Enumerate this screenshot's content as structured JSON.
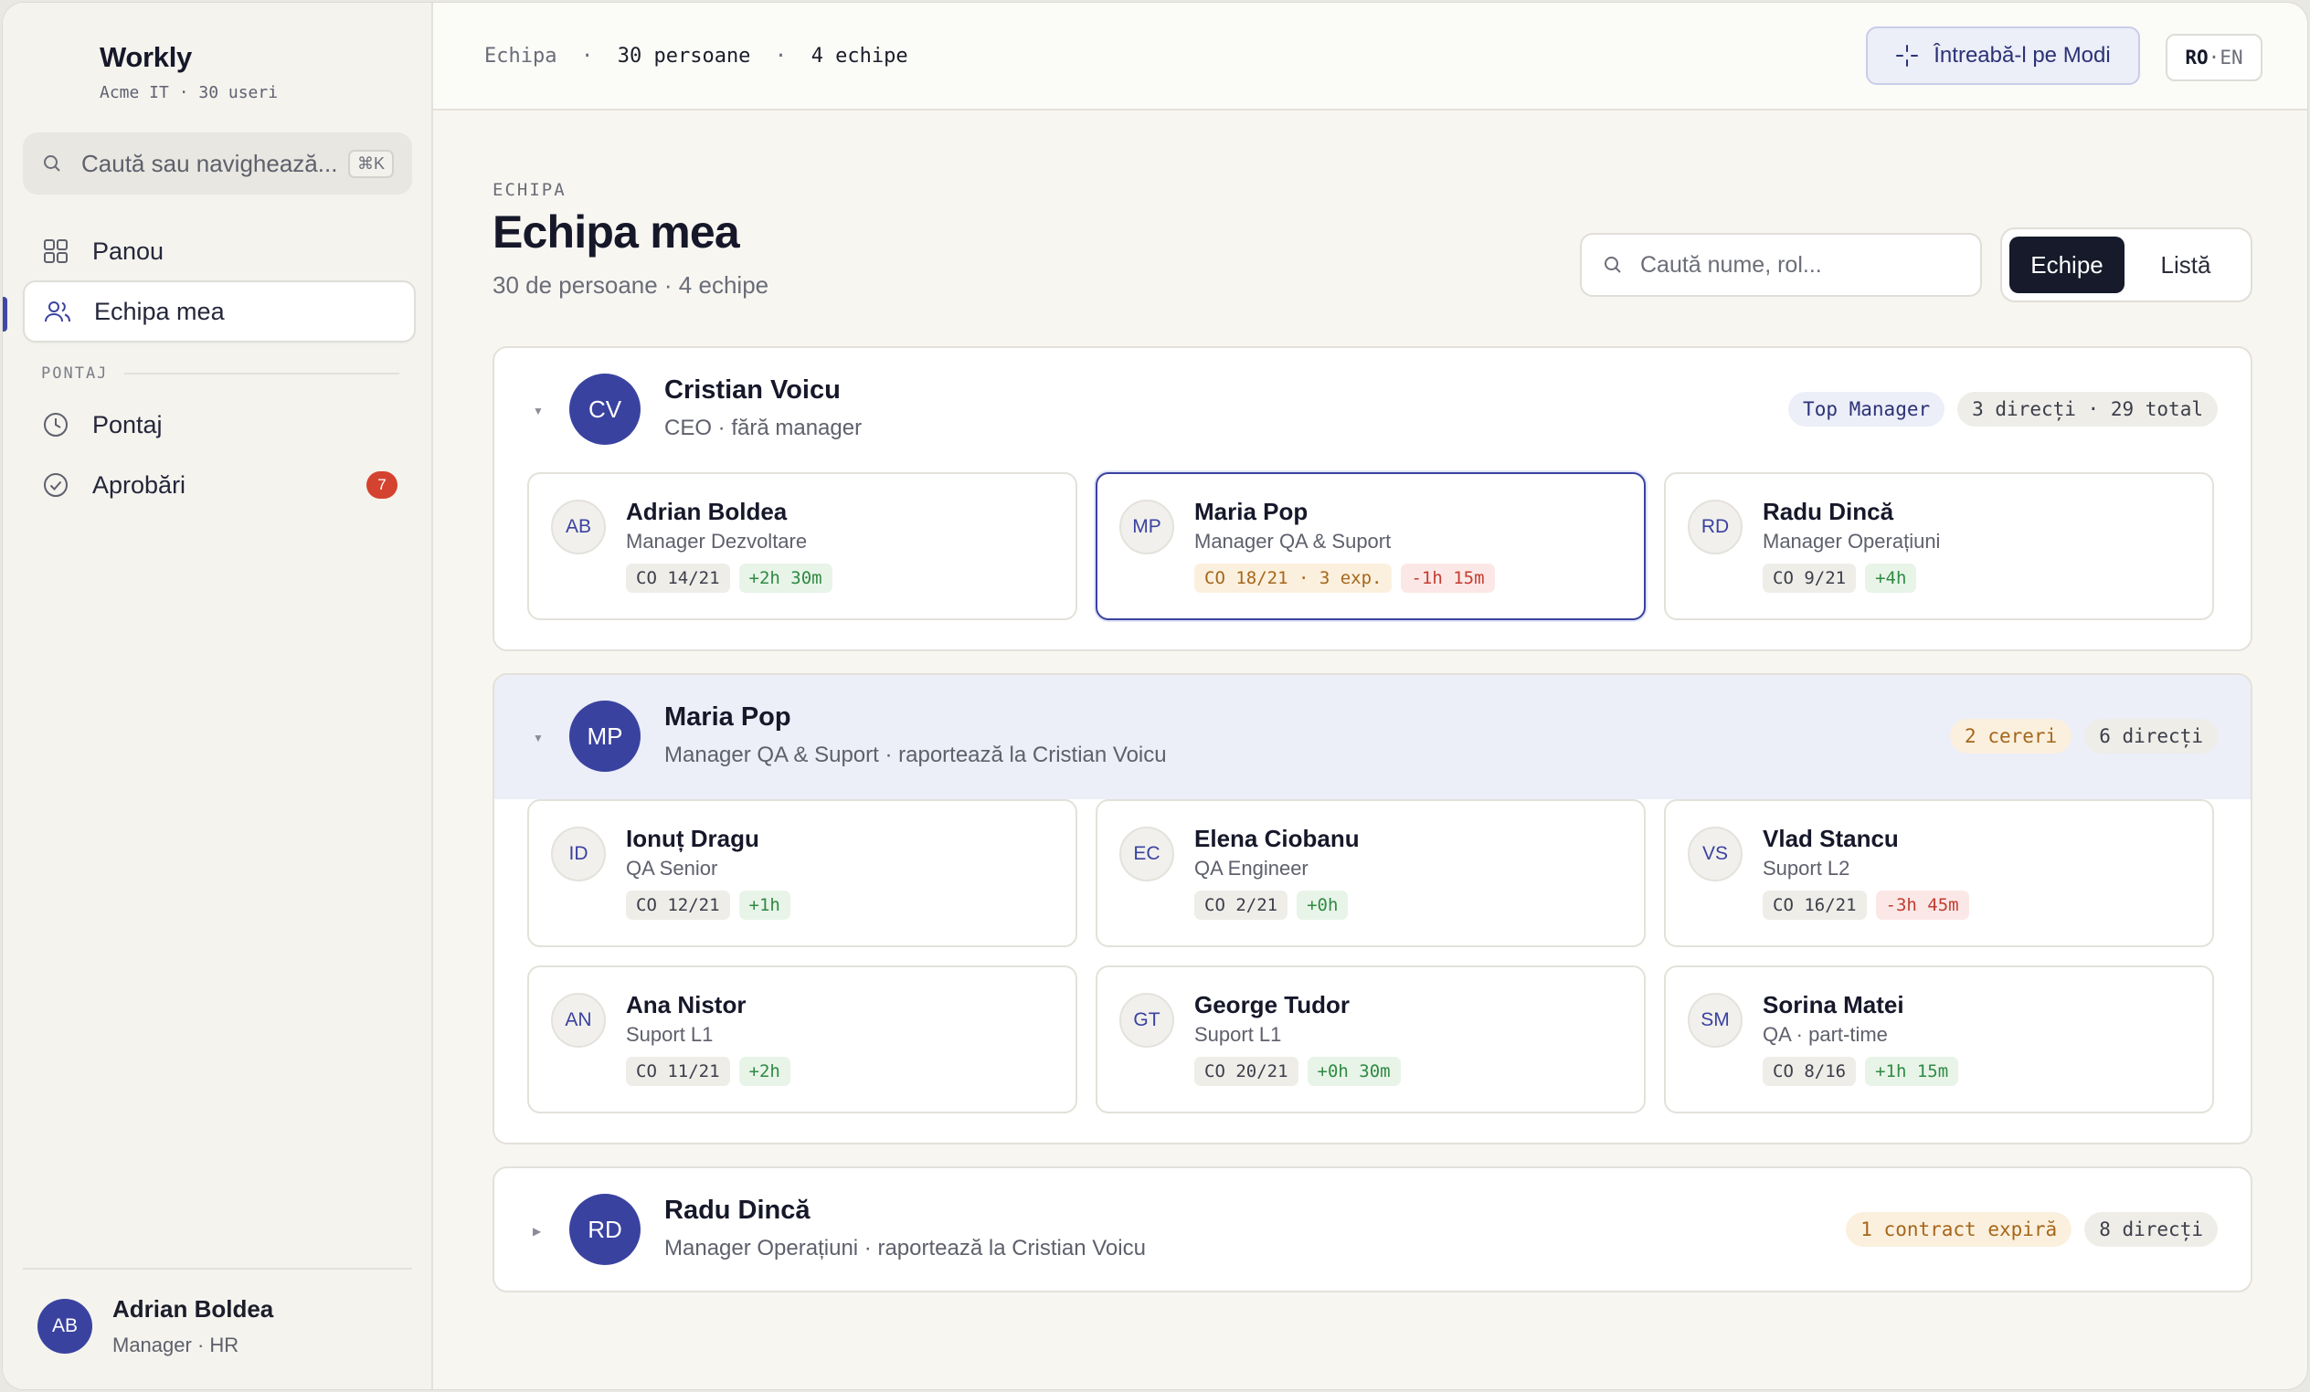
{
  "brand": {
    "name": "Workly",
    "subtitle": "Acme IT · 30 useri"
  },
  "sidebar": {
    "search": {
      "placeholder": "Caută sau navighează...",
      "shortcut": "⌘K"
    },
    "nav": [
      {
        "label": "Panou",
        "icon": "grid-icon"
      },
      {
        "label": "Echipa mea",
        "icon": "users-icon",
        "active": true
      }
    ],
    "section_label": "PONTAJ",
    "section_items": [
      {
        "label": "Pontaj",
        "icon": "clock-icon"
      },
      {
        "label": "Aprobări",
        "icon": "check-circle-icon",
        "badge": "7"
      }
    ],
    "user": {
      "initials": "AB",
      "name": "Adrian Boldea",
      "role": "Manager · HR"
    }
  },
  "topbar": {
    "crumb_section": "Echipa",
    "crumb_people": "30 persoane",
    "crumb_teams": "4 echipe",
    "ask_button": "Întreabă-l pe Modi",
    "lang_ro": "RO",
    "lang_en": "EN"
  },
  "page": {
    "kicker": "ECHIPA",
    "title": "Echipa mea",
    "subtitle": "30 de persoane · 4 echipe",
    "search_placeholder": "Caută nume, rol...",
    "view_teams": "Echipe",
    "view_list": "Listă"
  },
  "teams": [
    {
      "initials": "CV",
      "name": "Cristian Voicu",
      "subtitle": "CEO · fără manager",
      "tags": [
        {
          "text": "Top Manager",
          "tone": "blue"
        },
        {
          "text": "3 direcți · 29 total",
          "tone": "gray"
        }
      ],
      "members": [
        {
          "initials": "AB",
          "name": "Adrian Boldea",
          "role": "Manager Dezvoltare",
          "leave": "CO 14/21",
          "leave_tone": "gray",
          "balance": "+2h 30m",
          "balance_tone": "green"
        },
        {
          "initials": "MP",
          "name": "Maria Pop",
          "role": "Manager QA & Suport",
          "leave": "CO 18/21 · 3 exp.",
          "leave_tone": "amber",
          "balance": "-1h 15m",
          "balance_tone": "red",
          "selected": true
        },
        {
          "initials": "RD",
          "name": "Radu Dincă",
          "role": "Manager Operațiuni",
          "leave": "CO 9/21",
          "leave_tone": "gray",
          "balance": "+4h",
          "balance_tone": "green"
        }
      ]
    },
    {
      "initials": "MP",
      "name": "Maria Pop",
      "subtitle": "Manager QA & Suport · raportează la Cristian Voicu",
      "tags": [
        {
          "text": "2 cereri",
          "tone": "amber"
        },
        {
          "text": "6 direcți",
          "tone": "gray"
        }
      ],
      "members": [
        {
          "initials": "ID",
          "name": "Ionuț Dragu",
          "role": "QA Senior",
          "leave": "CO 12/21",
          "leave_tone": "gray",
          "balance": "+1h",
          "balance_tone": "green"
        },
        {
          "initials": "EC",
          "name": "Elena Ciobanu",
          "role": "QA Engineer",
          "leave": "CO 2/21",
          "leave_tone": "gray",
          "balance": "+0h",
          "balance_tone": "green"
        },
        {
          "initials": "VS",
          "name": "Vlad Stancu",
          "role": "Suport L2",
          "leave": "CO 16/21",
          "leave_tone": "gray",
          "balance": "-3h 45m",
          "balance_tone": "red"
        },
        {
          "initials": "AN",
          "name": "Ana Nistor",
          "role": "Suport L1",
          "leave": "CO 11/21",
          "leave_tone": "gray",
          "balance": "+2h",
          "balance_tone": "green"
        },
        {
          "initials": "GT",
          "name": "George Tudor",
          "role": "Suport L1",
          "leave": "CO 20/21",
          "leave_tone": "gray",
          "balance": "+0h 30m",
          "balance_tone": "green"
        },
        {
          "initials": "SM",
          "name": "Sorina Matei",
          "role": "QA · part-time",
          "leave": "CO 8/16",
          "leave_tone": "gray",
          "balance": "+1h 15m",
          "balance_tone": "green"
        }
      ]
    },
    {
      "initials": "RD",
      "name": "Radu Dincă",
      "subtitle": "Manager Operațiuni · raportează la Cristian Voicu",
      "tags": [
        {
          "text": "1 contract expiră",
          "tone": "amber"
        },
        {
          "text": "8 direcți",
          "tone": "gray"
        }
      ],
      "members": []
    }
  ],
  "colors": {
    "accent": "#3a42a0",
    "dark": "#161a2b",
    "danger": "#d4432f",
    "positive": "#2f8a43",
    "warning": "#a5661a"
  }
}
